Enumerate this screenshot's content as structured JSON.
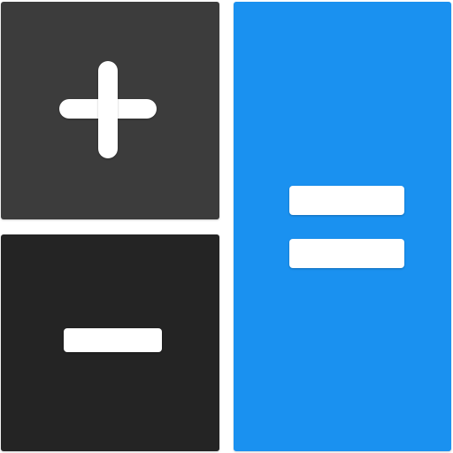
{
  "keys": [
    {
      "id": "plus",
      "icon": "plus-icon",
      "color": "#3c3c3c"
    },
    {
      "id": "minus",
      "icon": "minus-icon",
      "color": "#242424"
    },
    {
      "id": "equals",
      "icon": "equals-icon",
      "color": "#1a91f0"
    }
  ],
  "colors": {
    "background": "#ffffff",
    "glyph": "#ffffff"
  }
}
